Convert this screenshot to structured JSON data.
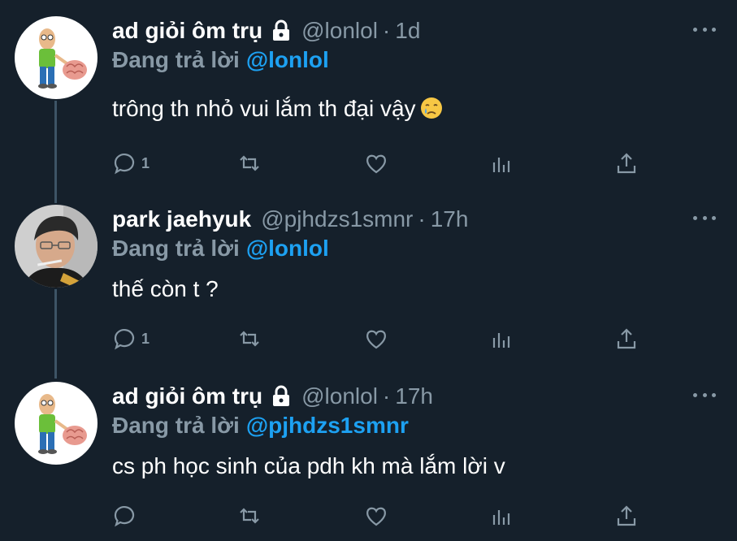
{
  "tweets": [
    {
      "name": "ad giỏi ôm trụ",
      "handle": "@lonlol",
      "dot": "·",
      "time": "1d",
      "locked": true,
      "reply_prefix": "Đang trả lời",
      "reply_to": "@lonlol",
      "text": "trông th nhỏ vui lắm th đại vậy",
      "emoji": "crying-face",
      "reply_count": "1",
      "avatar": "cartoon-man-with-brain-avatar"
    },
    {
      "name": "park jaehyuk",
      "handle": "@pjhdzs1smnr",
      "dot": "·",
      "time": "17h",
      "locked": false,
      "reply_prefix": "Đang trả lời",
      "reply_to": "@lonlol",
      "text": "thế còn t ?",
      "reply_count": "1",
      "avatar": "person-photo-avatar"
    },
    {
      "name": "ad giỏi ôm trụ",
      "handle": "@lonlol",
      "dot": "·",
      "time": "17h",
      "locked": true,
      "reply_prefix": "Đang trả lời",
      "reply_to": "@pjhdzs1smnr",
      "text": "cs ph học sinh của pdh kh mà lắm lời v",
      "reply_count": "",
      "avatar": "cartoon-man-with-brain-avatar"
    }
  ],
  "colors": {
    "background": "#15202b",
    "secondary_text": "#8899a6",
    "accent": "#1da1f2",
    "thread_line": "#3d5466"
  },
  "icons": [
    "reply-icon",
    "retweet-icon",
    "like-icon",
    "analytics-icon",
    "share-icon",
    "more-icon",
    "lock-icon"
  ]
}
